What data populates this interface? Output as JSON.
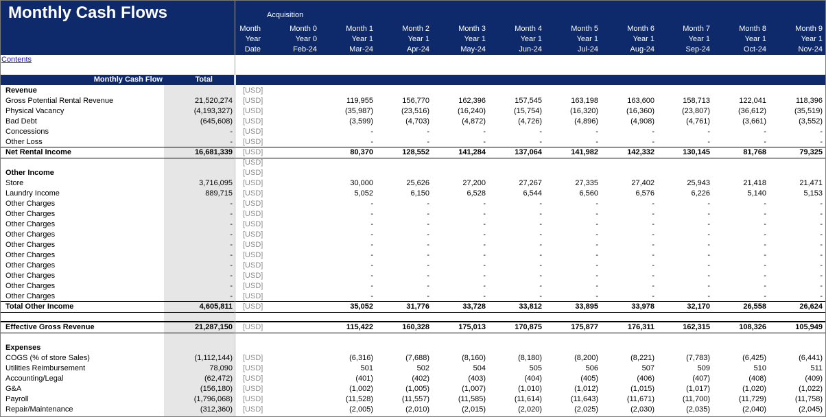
{
  "title": "Monthly Cash Flows",
  "acquisition_label": "Acquisition",
  "contents_link": "Contents",
  "header_row_labels": [
    "Month",
    "Year",
    "Date"
  ],
  "months": [
    {
      "month": "Month 0",
      "year": "Year 0",
      "date": "Feb-24"
    },
    {
      "month": "Month 1",
      "year": "Year 1",
      "date": "Mar-24"
    },
    {
      "month": "Month 2",
      "year": "Year 1",
      "date": "Apr-24"
    },
    {
      "month": "Month 3",
      "year": "Year 1",
      "date": "May-24"
    },
    {
      "month": "Month 4",
      "year": "Year 1",
      "date": "Jun-24"
    },
    {
      "month": "Month 5",
      "year": "Year 1",
      "date": "Jul-24"
    },
    {
      "month": "Month 6",
      "year": "Year 1",
      "date": "Aug-24"
    },
    {
      "month": "Month 7",
      "year": "Year 1",
      "date": "Sep-24"
    },
    {
      "month": "Month 8",
      "year": "Year 1",
      "date": "Oct-24"
    },
    {
      "month": "Month 9",
      "year": "Year 1",
      "date": "Nov-24"
    }
  ],
  "band": {
    "label": "Monthly Cash Flow",
    "total": "Total"
  },
  "rows": [
    {
      "label": "Revenue",
      "bold": true,
      "total": "",
      "unit": "[USD]",
      "vals": []
    },
    {
      "label": "Gross Potential Rental Revenue",
      "total": "21,520,274",
      "unit": "[USD]",
      "vals": [
        "",
        "119,955",
        "156,770",
        "162,396",
        "157,545",
        "163,198",
        "163,600",
        "158,713",
        "122,041",
        "118,396"
      ]
    },
    {
      "label": "Physical Vacancy",
      "total": "(4,193,327)",
      "unit": "[USD]",
      "vals": [
        "",
        "(35,987)",
        "(23,516)",
        "(16,240)",
        "(15,754)",
        "(16,320)",
        "(16,360)",
        "(23,807)",
        "(36,612)",
        "(35,519)"
      ]
    },
    {
      "label": "Bad Debt",
      "total": "(645,608)",
      "unit": "[USD]",
      "vals": [
        "",
        "(3,599)",
        "(4,703)",
        "(4,872)",
        "(4,726)",
        "(4,896)",
        "(4,908)",
        "(4,761)",
        "(3,661)",
        "(3,552)"
      ]
    },
    {
      "label": "Concessions",
      "total": "-",
      "unit": "[USD]",
      "vals": [
        "",
        "-",
        "-",
        "-",
        "-",
        "-",
        "-",
        "-",
        "-",
        "-"
      ]
    },
    {
      "label": "Other Loss",
      "total": "-",
      "unit": "[USD]",
      "vals": [
        "",
        "-",
        "-",
        "-",
        "-",
        "-",
        "-",
        "-",
        "-",
        "-"
      ]
    },
    {
      "label": "Net Rental Income",
      "bold": true,
      "line": "top",
      "total": "16,681,339",
      "unit": "[USD]",
      "vals": [
        "",
        "80,370",
        "128,552",
        "141,284",
        "137,064",
        "141,982",
        "142,332",
        "130,145",
        "81,768",
        "79,325"
      ]
    },
    {
      "label": "",
      "total": "",
      "unit": "[USD]",
      "vals": []
    },
    {
      "label": "Other Income",
      "bold": true,
      "total": "",
      "unit": "[USD]",
      "vals": []
    },
    {
      "label": "Store",
      "total": "3,716,095",
      "unit": "[USD]",
      "vals": [
        "",
        "30,000",
        "25,626",
        "27,200",
        "27,267",
        "27,335",
        "27,402",
        "25,943",
        "21,418",
        "21,471"
      ]
    },
    {
      "label": "Laundry Income",
      "total": "889,715",
      "unit": "[USD]",
      "vals": [
        "",
        "5,052",
        "6,150",
        "6,528",
        "6,544",
        "6,560",
        "6,576",
        "6,226",
        "5,140",
        "5,153"
      ]
    },
    {
      "label": "Other Charges",
      "total": "-",
      "unit": "[USD]",
      "vals": [
        "",
        "-",
        "-",
        "-",
        "-",
        "-",
        "-",
        "-",
        "-",
        "-"
      ]
    },
    {
      "label": "Other Charges",
      "total": "-",
      "unit": "[USD]",
      "vals": [
        "",
        "-",
        "-",
        "-",
        "-",
        "-",
        "-",
        "-",
        "-",
        "-"
      ]
    },
    {
      "label": "Other Charges",
      "total": "-",
      "unit": "[USD]",
      "vals": [
        "",
        "-",
        "-",
        "-",
        "-",
        "-",
        "-",
        "-",
        "-",
        "-"
      ]
    },
    {
      "label": "Other Charges",
      "total": "-",
      "unit": "[USD]",
      "vals": [
        "",
        "-",
        "-",
        "-",
        "-",
        "-",
        "-",
        "-",
        "-",
        "-"
      ]
    },
    {
      "label": "Other Charges",
      "total": "-",
      "unit": "[USD]",
      "vals": [
        "",
        "-",
        "-",
        "-",
        "-",
        "-",
        "-",
        "-",
        "-",
        "-"
      ]
    },
    {
      "label": "Other Charges",
      "total": "-",
      "unit": "[USD]",
      "vals": [
        "",
        "-",
        "-",
        "-",
        "-",
        "-",
        "-",
        "-",
        "-",
        "-"
      ]
    },
    {
      "label": "Other Charges",
      "total": "-",
      "unit": "[USD]",
      "vals": [
        "",
        "-",
        "-",
        "-",
        "-",
        "-",
        "-",
        "-",
        "-",
        "-"
      ]
    },
    {
      "label": "Other Charges",
      "total": "-",
      "unit": "[USD]",
      "vals": [
        "",
        "-",
        "-",
        "-",
        "-",
        "-",
        "-",
        "-",
        "-",
        "-"
      ]
    },
    {
      "label": "Other Charges",
      "total": "-",
      "unit": "[USD]",
      "vals": [
        "",
        "-",
        "-",
        "-",
        "-",
        "-",
        "-",
        "-",
        "-",
        "-"
      ]
    },
    {
      "label": "Other Charges",
      "total": "-",
      "unit": "[USD]",
      "vals": [
        "",
        "-",
        "-",
        "-",
        "-",
        "-",
        "-",
        "-",
        "-",
        "-"
      ]
    },
    {
      "label": "Total Other Income",
      "bold": true,
      "line": "top",
      "total": "4,605,811",
      "unit": "[USD]",
      "vals": [
        "",
        "35,052",
        "31,776",
        "33,728",
        "33,812",
        "33,895",
        "33,978",
        "32,170",
        "26,558",
        "26,624"
      ]
    },
    {
      "label": "",
      "total": "",
      "unit": "",
      "vals": []
    },
    {
      "label": "Effective Gross Revenue",
      "bold": true,
      "line": "double",
      "total": "21,287,150",
      "unit": "[USD]",
      "vals": [
        "",
        "115,422",
        "160,328",
        "175,013",
        "170,875",
        "175,877",
        "176,311",
        "162,315",
        "108,326",
        "105,949"
      ]
    },
    {
      "label": "",
      "total": "",
      "unit": "",
      "vals": []
    },
    {
      "label": "Expenses",
      "bold": true,
      "total": "",
      "unit": "",
      "vals": []
    },
    {
      "label": "COGS (% of store Sales)",
      "total": "(1,112,144)",
      "unit": "[USD]",
      "vals": [
        "",
        "(6,316)",
        "(7,688)",
        "(8,160)",
        "(8,180)",
        "(8,200)",
        "(8,221)",
        "(7,783)",
        "(6,425)",
        "(6,441)"
      ]
    },
    {
      "label": "Utilities Reimbursement",
      "total": "78,090",
      "unit": "[USD]",
      "vals": [
        "",
        "501",
        "502",
        "504",
        "505",
        "506",
        "507",
        "509",
        "510",
        "511"
      ]
    },
    {
      "label": "Accounting/Legal",
      "total": "(62,472)",
      "unit": "[USD]",
      "vals": [
        "",
        "(401)",
        "(402)",
        "(403)",
        "(404)",
        "(405)",
        "(406)",
        "(407)",
        "(408)",
        "(409)"
      ]
    },
    {
      "label": "G&A",
      "total": "(156,180)",
      "unit": "[USD]",
      "vals": [
        "",
        "(1,002)",
        "(1,005)",
        "(1,007)",
        "(1,010)",
        "(1,012)",
        "(1,015)",
        "(1,017)",
        "(1,020)",
        "(1,022)"
      ]
    },
    {
      "label": "Payroll",
      "total": "(1,796,068)",
      "unit": "[USD]",
      "vals": [
        "",
        "(11,528)",
        "(11,557)",
        "(11,585)",
        "(11,614)",
        "(11,643)",
        "(11,671)",
        "(11,700)",
        "(11,729)",
        "(11,758)"
      ]
    },
    {
      "label": "Repair/Maintenance",
      "total": "(312,360)",
      "unit": "[USD]",
      "vals": [
        "",
        "(2,005)",
        "(2,010)",
        "(2,015)",
        "(2,020)",
        "(2,025)",
        "(2,030)",
        "(2,035)",
        "(2,040)",
        "(2,045)"
      ]
    }
  ]
}
